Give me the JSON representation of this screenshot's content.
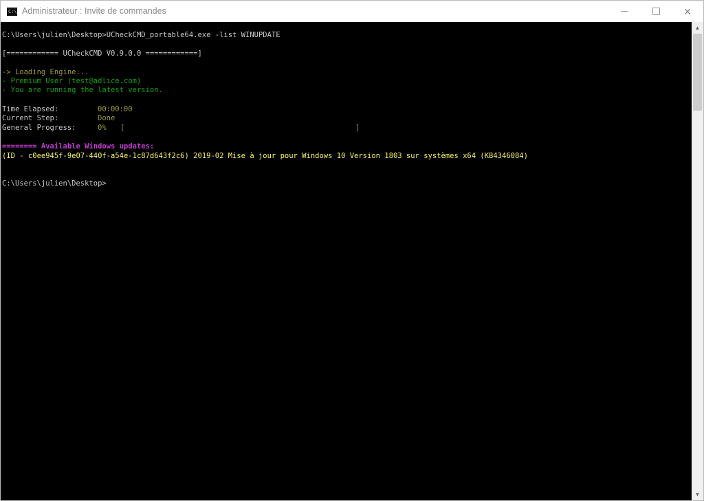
{
  "window": {
    "title": "Administrateur : Invite de commandes",
    "icon": "cmd-icon",
    "icon_text": "C:\\",
    "controls": {
      "minimize": "minimize-icon",
      "maximize": "maximize-icon",
      "close": "close-icon",
      "close_glyph": "✕"
    }
  },
  "console": {
    "command_line": "C:\\Users\\julien\\Desktop>UCheckCMD_portable64.exe -list WINUPDATE",
    "banner": "[============ UCheckCMD V0.9.0.0 ============]",
    "status_lines": [
      "-> Loading Engine...",
      "- Premium User (test@adlice.com)",
      "- You are running the latest version."
    ],
    "time_elapsed": {
      "label": "Time Elapsed:",
      "value": "00:00:00"
    },
    "current_step": {
      "label": "Current Step:",
      "value": "Done"
    },
    "general_progress": {
      "label": "General Progress:",
      "value": "0%",
      "bar_open": "[",
      "bar_close": "]",
      "fraction": 0
    },
    "updates_header": "======== Available Windows updates:",
    "update_entry": "(ID - c0ee945f-9e07-440f-a54e-1c87d643f2c6) 2019-02 Mise à jour pour Windows 10 Version 1803 sur systèmes x64 (KB4346084)",
    "prompt": "C:\\Users\\julien\\Desktop>"
  },
  "scrollbar": {
    "up_icon": "scroll-up-arrow-icon",
    "down_icon": "scroll-down-arrow-icon",
    "up_glyph": "▲",
    "down_glyph": "▼"
  },
  "colors": {
    "console_bg": "#000000",
    "text_white": "#c8c8c8",
    "text_green": "#13a10e",
    "text_olive": "#9b9a3a",
    "text_magenta": "#c13ad0",
    "text_yellow": "#f6f36a"
  }
}
